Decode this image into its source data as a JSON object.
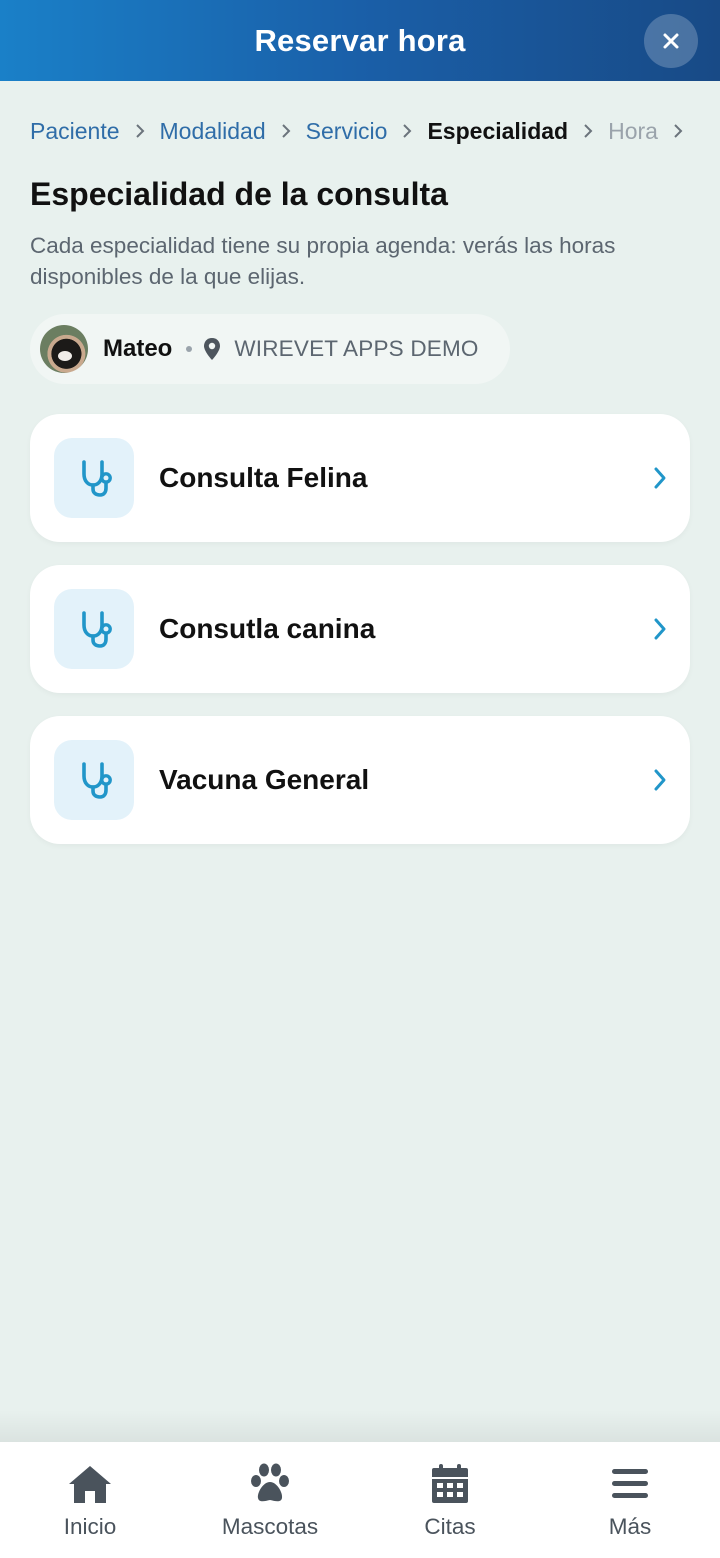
{
  "header": {
    "title": "Reservar hora",
    "close_icon": "close-icon"
  },
  "breadcrumb": [
    {
      "label": "Paciente",
      "state": "done"
    },
    {
      "label": "Modalidad",
      "state": "done"
    },
    {
      "label": "Servicio",
      "state": "done"
    },
    {
      "label": "Especialidad",
      "state": "active"
    },
    {
      "label": "Hora",
      "state": "future"
    }
  ],
  "page": {
    "title": "Especialidad de la consulta",
    "subtitle": "Cada especialidad tiene su propia agenda: verás las horas disponibles de la que elijas."
  },
  "patient": {
    "name": "Mateo",
    "clinic": "WIREVET APPS DEMO",
    "clinic_icon": "location-pin-icon"
  },
  "specialties": [
    {
      "label": "Consulta Felina",
      "icon": "stethoscope-icon"
    },
    {
      "label": "Consutla canina",
      "icon": "stethoscope-icon"
    },
    {
      "label": "Vacuna General",
      "icon": "stethoscope-icon"
    }
  ],
  "bottom_nav": [
    {
      "label": "Inicio",
      "icon": "home-icon"
    },
    {
      "label": "Mascotas",
      "icon": "paw-icon"
    },
    {
      "label": "Citas",
      "icon": "calendar-icon"
    },
    {
      "label": "Más",
      "icon": "menu-icon"
    }
  ],
  "colors": {
    "header_start": "#1a80c8",
    "header_end": "#184a86",
    "accent": "#2196c9",
    "background": "#e8f1ee",
    "breadcrumb_link": "#2f6da8"
  }
}
